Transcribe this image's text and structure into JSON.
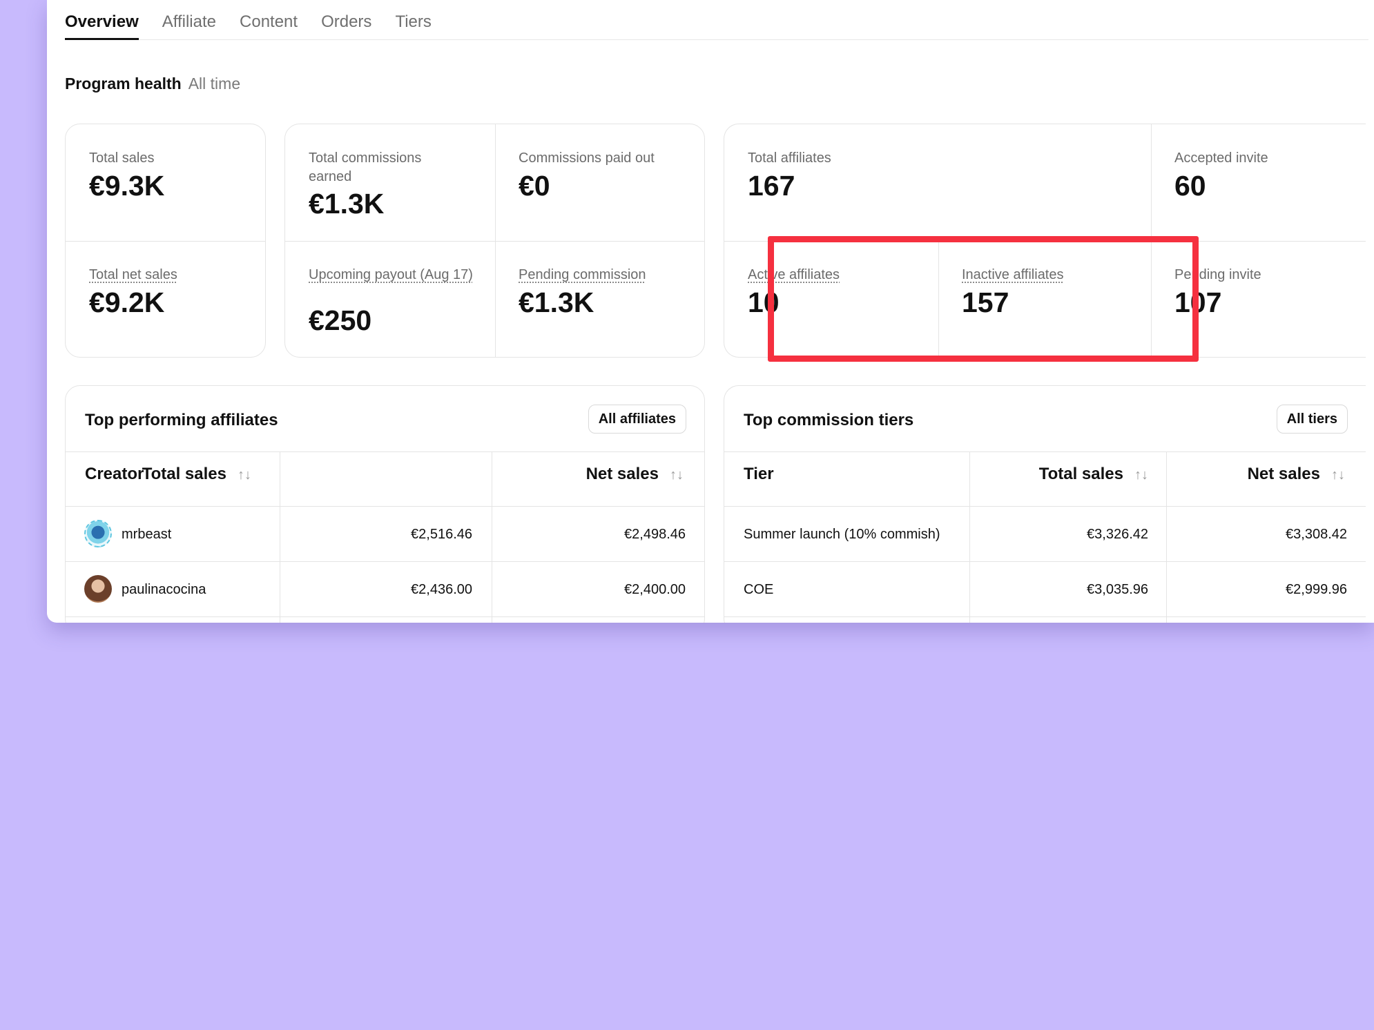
{
  "tabs": [
    "Overview",
    "Affiliate",
    "Content",
    "Orders",
    "Tiers"
  ],
  "program_health": {
    "title": "Program health",
    "period": "All time"
  },
  "stats": {
    "total_sales": {
      "label": "Total sales",
      "value": "€9.3K"
    },
    "total_net_sales": {
      "label": "Total net sales",
      "value": "€9.2K"
    },
    "total_commissions_earned": {
      "label": "Total commissions earned",
      "value": "€1.3K"
    },
    "commissions_paid_out": {
      "label": "Commissions paid out",
      "value": "€0"
    },
    "upcoming_payout": {
      "label": "Upcoming payout (Aug 17)",
      "value": "€250"
    },
    "pending_commission": {
      "label": "Pending commission",
      "value": "€1.3K"
    },
    "total_affiliates": {
      "label": "Total affiliates",
      "value": "167"
    },
    "accepted_invite": {
      "label": "Accepted invite",
      "value": "60"
    },
    "active_affiliates": {
      "label": "Active affiliates",
      "value": "10"
    },
    "inactive_affiliates": {
      "label": "Inactive affiliates",
      "value": "157"
    },
    "pending_invite": {
      "label": "Pending invite",
      "value": "107"
    }
  },
  "highlight_color": "#f5303f",
  "top_affiliates": {
    "title": "Top performing affiliates",
    "button": "All affiliates",
    "columns": [
      "Creator",
      "Total sales",
      "Net sales"
    ],
    "sort_icon": "↑↓",
    "rows": [
      {
        "creator": "mrbeast",
        "total_sales": "€2,516.46",
        "net_sales": "€2,498.46"
      },
      {
        "creator": "paulinacocina",
        "total_sales": "€2,436.00",
        "net_sales": "€2,400.00"
      }
    ]
  },
  "top_tiers": {
    "title": "Top commission tiers",
    "button": "All tiers",
    "columns": [
      "Tier",
      "Total sales",
      "Net sales"
    ],
    "rows": [
      {
        "tier": "Summer launch (10% commish)",
        "total_sales": "€3,326.42",
        "net_sales": "€3,308.42"
      },
      {
        "tier": "COE",
        "total_sales": "€3,035.96",
        "net_sales": "€2,999.96"
      }
    ]
  }
}
